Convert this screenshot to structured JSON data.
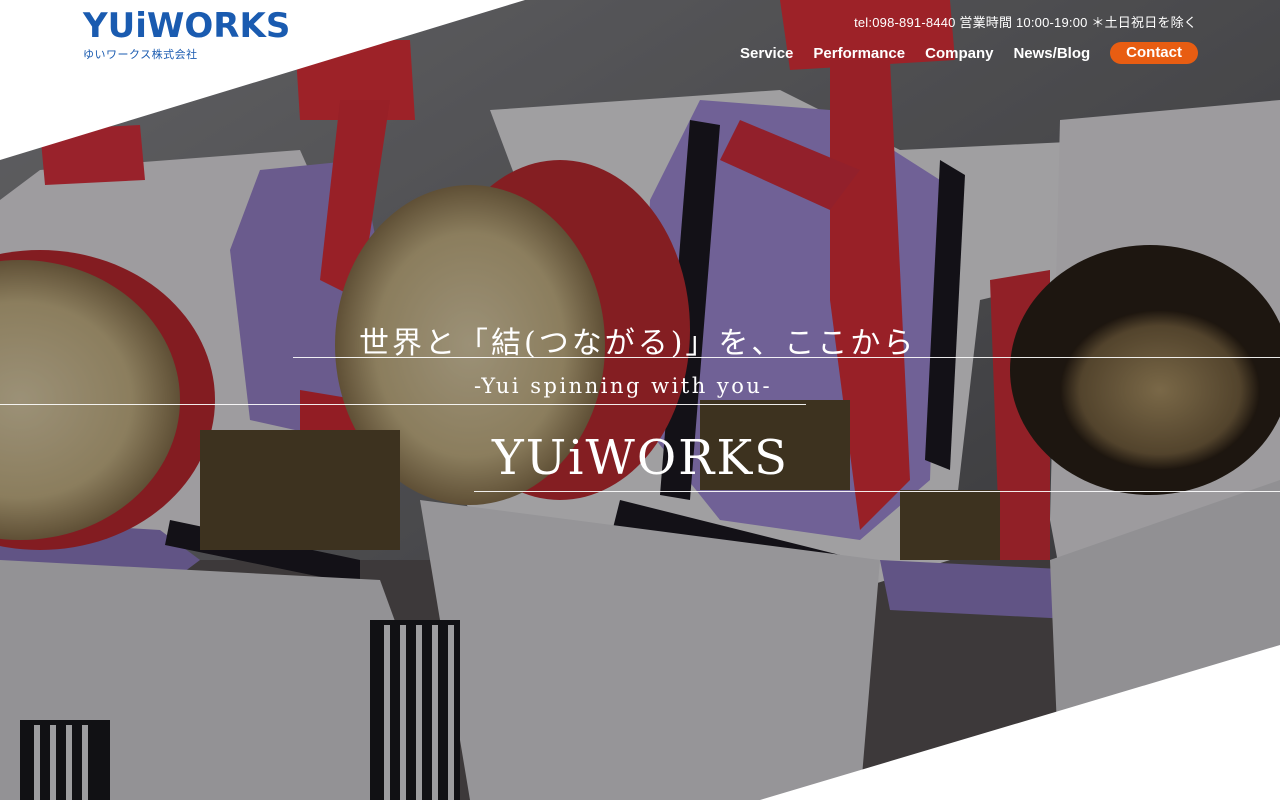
{
  "brand": {
    "logo_text": "YUiWORKS",
    "logo_sub": "ゆいワークス株式会社",
    "color": "#1a5bb0"
  },
  "header": {
    "contact_info": "tel:098-891-8440 営業時間 10:00-19:00 ＊土日祝日を除く"
  },
  "nav": {
    "items": [
      {
        "label": "Service"
      },
      {
        "label": "Performance"
      },
      {
        "label": "Company"
      },
      {
        "label": "News/Blog"
      }
    ],
    "contact_label": "Contact",
    "contact_color": "#e85d12"
  },
  "hero": {
    "tagline": "世界と「結(つながる)」を、ここから",
    "subtitle": "-Yui spinning with you-",
    "title": "YUiWORKS"
  }
}
